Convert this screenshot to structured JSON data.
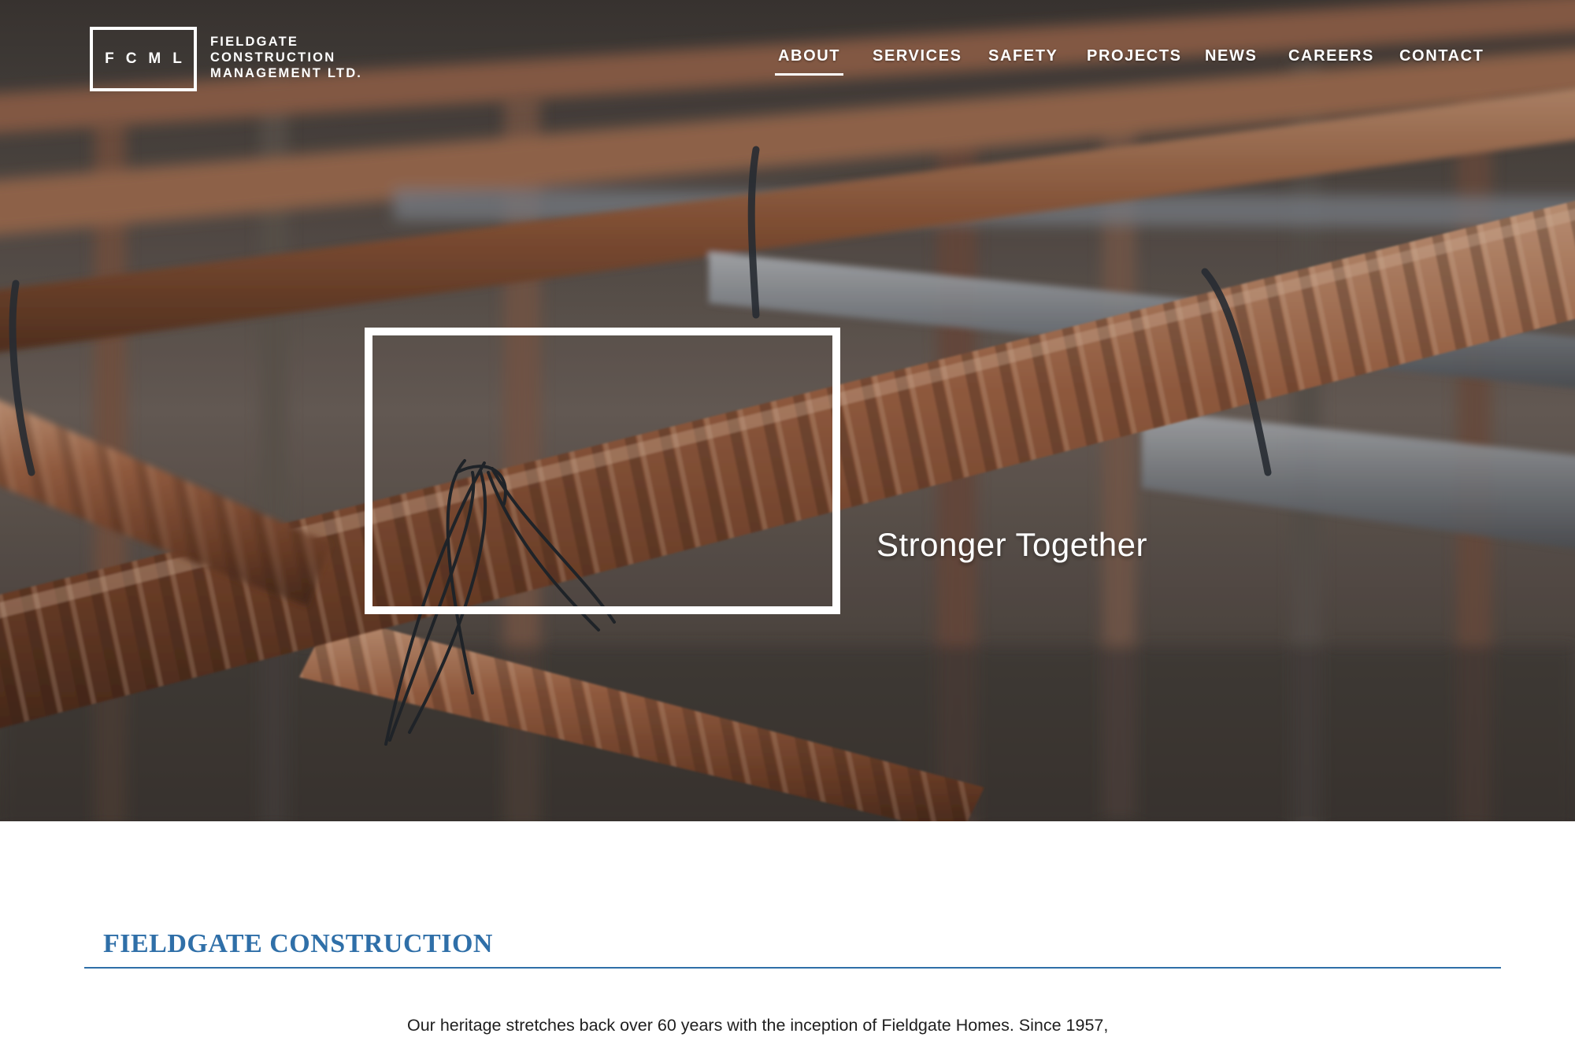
{
  "header": {
    "logo_mark": "FCML",
    "logo_lines": [
      "FIELDGATE",
      "CONSTRUCTION",
      "MANAGEMENT LTD."
    ]
  },
  "nav": {
    "items": [
      {
        "label": "ABOUT",
        "active": true
      },
      {
        "label": "SERVICES",
        "active": false
      },
      {
        "label": "SAFETY",
        "active": false
      },
      {
        "label": "PROJECTS",
        "active": false
      },
      {
        "label": "NEWS",
        "active": false
      },
      {
        "label": "CAREERS",
        "active": false
      },
      {
        "label": "CONTACT",
        "active": false
      }
    ]
  },
  "hero": {
    "heading": "Stronger Together",
    "image_subject": "close-up of rusty rebar tied with black wire"
  },
  "section": {
    "title": "FIELDGATE CONSTRUCTION",
    "intro": "Our heritage stretches back over 60 years with the inception of Fieldgate Homes. Since 1957,"
  },
  "colors": {
    "accent": "#2f6fa8",
    "text": "#1e1e1e",
    "hero_overlay_text": "#ffffff"
  }
}
